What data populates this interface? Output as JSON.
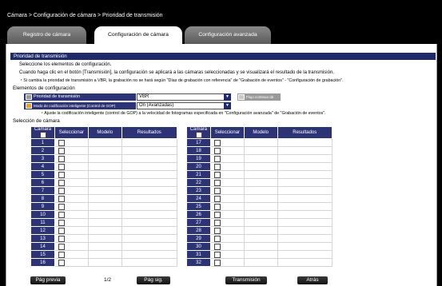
{
  "breadcrumb": "Cámara > Configuración de cámara > Prioridad de transmisión",
  "tabs": [
    {
      "label": "Registro de cámara",
      "active": false
    },
    {
      "label": "Configuración de cámara",
      "active": true
    },
    {
      "label": "Configuración avanzada",
      "active": false
    }
  ],
  "section_title": "Prioridad de transmisión",
  "instructions": {
    "line1": "Seleccione los elementos de configuración.",
    "line2": "Cuando haga clic en el botón [Transmisión], la configuración se aplicará a las cámaras seleccionadas y se visualizará el resultado de la transmisión.",
    "note": "・Si cambia la prioridad de transmisión a VBR, la grabación no se hará según \"Días de grabación con referencia\" de \"Grabación de eventos\" - \"Configuración de grabación\"."
  },
  "config_items_heading": "Elementos de configuración",
  "config": {
    "priority_label": "Prioridad de transmisión",
    "priority_value": "VBR",
    "rate_label": "Flujo continuo de vídeo 1",
    "gop_label": "Modo de codificación inteligente (Control de GOP)",
    "gop_value": "On (Avanzadas)",
    "gop_note": "・Ajuste la codificación inteligente (control de GOP) a la velocidad de fotogramas especificada en \"Configuración avanzada\" de \"Grabación de eventos\"."
  },
  "camera_select_heading": "Selección de cámara",
  "columns": [
    "Cámara",
    "Seleccionar",
    "Modelo",
    "Resultados"
  ],
  "cameras_left": [
    "1",
    "2",
    "3",
    "4",
    "5",
    "6",
    "7",
    "8",
    "9",
    "10",
    "11",
    "12",
    "13",
    "14",
    "15",
    "16"
  ],
  "cameras_right": [
    "17",
    "18",
    "19",
    "20",
    "21",
    "22",
    "23",
    "24",
    "25",
    "26",
    "27",
    "28",
    "29",
    "30",
    "31",
    "32"
  ],
  "footer": {
    "prev": "Pág previa",
    "page": "1/2",
    "next": "Pág sig.",
    "transmit": "Transmisión",
    "back": "Atrás"
  },
  "colors": {
    "header_navy": "#1f2a6b",
    "cell_navy": "#2c3377",
    "gop_icon": "#e8a423"
  }
}
